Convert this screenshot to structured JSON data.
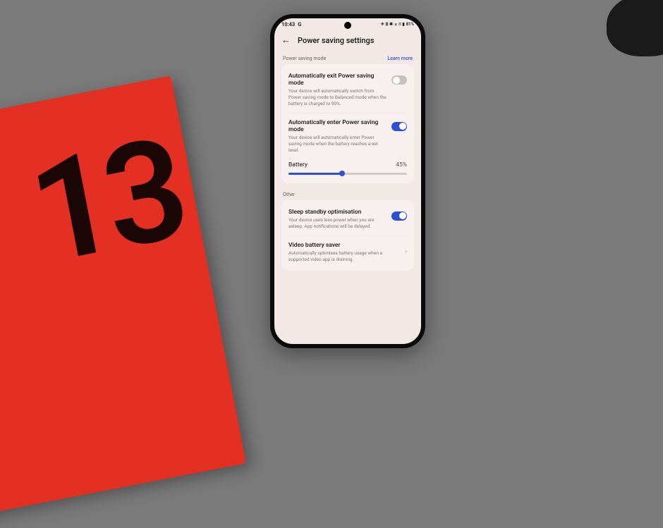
{
  "status": {
    "time": "10:43",
    "extra": "G",
    "battery_text": "81%",
    "icons": "✈ ⧖ ✱ ⌅ ⁝⁝ ▮"
  },
  "header": {
    "title": "Power saving settings"
  },
  "sections": {
    "mode": {
      "label": "Power saving mode",
      "learn_more": "Learn more"
    },
    "other": {
      "label": "Other"
    }
  },
  "settings": {
    "auto_exit": {
      "title": "Automatically exit Power saving mode",
      "desc": "Your device will automatically switch from Power saving mode to Balanced mode when the battery is charged to 90%.",
      "on": false
    },
    "auto_enter": {
      "title": "Automatically enter Power saving mode",
      "desc": "Your device will automatically enter Power saving mode when the battery reaches a set level.",
      "on": true
    },
    "battery_slider": {
      "label": "Battery",
      "value": "45%",
      "percent": 45
    },
    "sleep": {
      "title": "Sleep standby optimisation",
      "desc": "Your device uses less power when you are asleep. App notifications will be delayed.",
      "on": true
    },
    "video": {
      "title": "Video battery saver",
      "desc": "Automatically optimises battery usage when a supported video app is draining"
    }
  }
}
